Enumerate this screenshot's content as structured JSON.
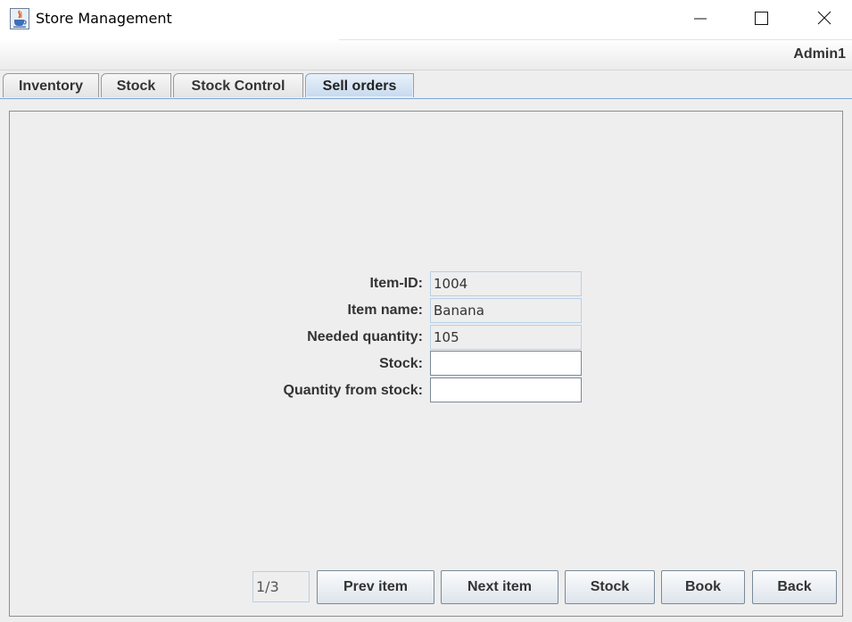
{
  "window": {
    "title": "Store Management",
    "icon": "java-coffee-cup-icon",
    "controls": [
      "minimize-icon",
      "maximize-icon",
      "close-icon"
    ]
  },
  "header": {
    "user": "Admin1"
  },
  "tabs": [
    {
      "label": "Inventory",
      "active": false
    },
    {
      "label": "Stock",
      "active": false
    },
    {
      "label": "Stock Control",
      "active": false
    },
    {
      "label": "Sell orders",
      "active": true
    }
  ],
  "form": {
    "item_id": {
      "label": "Item-ID:",
      "value": "1004"
    },
    "item_name": {
      "label": "Item name:",
      "value": "Banana"
    },
    "needed_quantity": {
      "label": "Needed quantity:",
      "value": "105"
    },
    "stock": {
      "label": "Stock:",
      "value": ""
    },
    "quantity_from_stock": {
      "label": "Quantity from stock:",
      "value": ""
    }
  },
  "pager": {
    "indicator": "1/3"
  },
  "buttons": {
    "prev": "Prev item",
    "next": "Next item",
    "stock": "Stock",
    "book": "Book",
    "back": "Back"
  },
  "colors": {
    "active_tab": "#c6d9ed",
    "panel_bg": "#eeeeee",
    "field_border": "#b8cfe5"
  }
}
